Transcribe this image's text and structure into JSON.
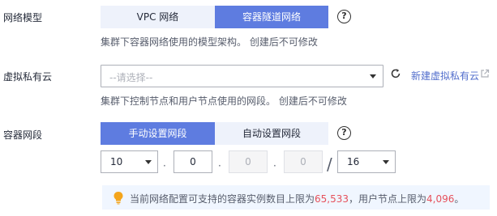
{
  "network_model": {
    "label": "网络模型",
    "options": [
      "VPC 网络",
      "容器隧道网络"
    ],
    "selected": "容器隧道网络",
    "hint": "集群下容器网络使用的模型架构。 创建后不可修改"
  },
  "vpc": {
    "label": "虚拟私有云",
    "placeholder": "--请选择--",
    "create_link": "新建虚拟私有云",
    "hint": "集群下控制节点和用户节点使用的网段。 创建后不可修改"
  },
  "container_cidr": {
    "label": "容器网段",
    "options": [
      "手动设置网段",
      "自动设置网段"
    ],
    "selected": "手动设置网段",
    "octet1": "10",
    "octet2": "0",
    "octet3": "0",
    "octet4": "0",
    "mask": "16"
  },
  "notice": {
    "prefix": "当前网络配置可支持的容器实例数目上限为",
    "container_limit": "65,533",
    "middle": "，用户节点上限为",
    "node_limit": "4,096",
    "suffix": "。"
  },
  "colors": {
    "primary": "#5e7ce0",
    "inactive_bg": "#eef2fb",
    "link": "#526ecc",
    "number": "#e6515c",
    "notice_bg": "#f0f6ff",
    "bulb": "#f4a51c"
  }
}
